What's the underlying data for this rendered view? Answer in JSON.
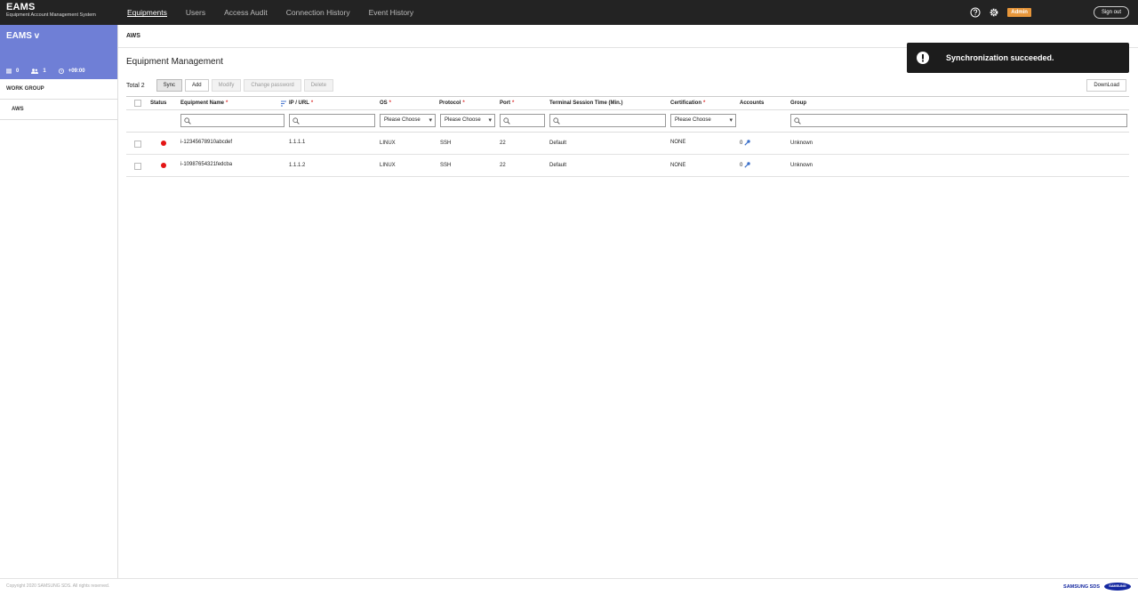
{
  "app": {
    "brand_title": "EAMS",
    "brand_subtitle": "Equipment Account Management System"
  },
  "nav": {
    "items": [
      {
        "label": "Equipments",
        "active": true
      },
      {
        "label": "Users",
        "active": false
      },
      {
        "label": "Access Audit",
        "active": false
      },
      {
        "label": "Connection History",
        "active": false
      },
      {
        "label": "Event History",
        "active": false
      }
    ],
    "admin_badge": "Admin",
    "sign_out": "Sign out"
  },
  "sidebar": {
    "title": "EAMS v",
    "stats": {
      "equipments": "0",
      "users": "1",
      "timezone": "+09:00"
    },
    "section_label": "WORK GROUP",
    "items": [
      {
        "label": "AWS"
      }
    ]
  },
  "main": {
    "breadcrumb": "AWS",
    "page_title": "Equipment Management",
    "total": "Total 2",
    "buttons": {
      "sync": "Sync",
      "add": "Add",
      "modify": "Modify",
      "change_password": "Change password",
      "delete": "Delete",
      "download": "DownLoad"
    }
  },
  "table": {
    "columns": [
      {
        "key": "status",
        "label": "Status",
        "required": false
      },
      {
        "key": "name",
        "label": "Equipment Name",
        "required": true
      },
      {
        "key": "ip",
        "label": "IP / URL",
        "required": true
      },
      {
        "key": "os",
        "label": "OS",
        "required": true
      },
      {
        "key": "protocol",
        "label": "Protocol",
        "required": true
      },
      {
        "key": "port",
        "label": "Port",
        "required": true
      },
      {
        "key": "session",
        "label": "Terminal Session Time (Min.)",
        "required": false
      },
      {
        "key": "cert",
        "label": "Certification",
        "required": true
      },
      {
        "key": "accounts",
        "label": "Accounts",
        "required": false
      },
      {
        "key": "group",
        "label": "Group",
        "required": false
      }
    ],
    "required_mark": "*",
    "filter_select_placeholder": "Please Choose",
    "rows": [
      {
        "name": "i-12345678910abcdef",
        "ip": "1.1.1.1",
        "os": "LINUX",
        "protocol": "SSH",
        "port": "22",
        "session": "Default",
        "cert": "NONE",
        "accounts": "0",
        "group": "Unknown"
      },
      {
        "name": "i-10987654321fedcba",
        "ip": "1.1.1.2",
        "os": "LINUX",
        "protocol": "SSH",
        "port": "22",
        "session": "Default",
        "cert": "NONE",
        "accounts": "0",
        "group": "Unknown"
      }
    ]
  },
  "toast": {
    "message": "Synchronization succeeded."
  },
  "footer": {
    "copyright": "Copyright 2020 SAMSUNG SDS. All rights reserved.",
    "logo_text": "SAMSUNG SDS",
    "logo_oval": "SAMSUNG"
  },
  "colors": {
    "topbar": "#232323",
    "sidebar_header": "#6f7fd6",
    "status_offline": "#e41515",
    "admin_badge": "#e7963a",
    "brand_blue": "#1428a0"
  }
}
